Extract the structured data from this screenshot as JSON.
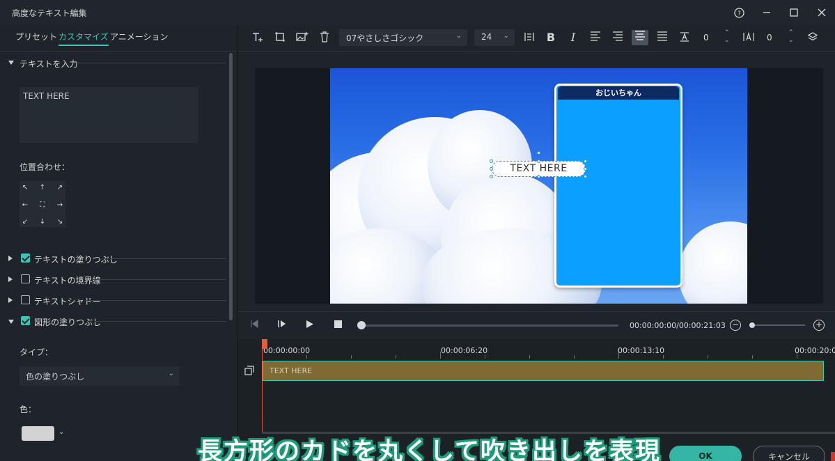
{
  "window": {
    "title": "高度なテキスト編集",
    "help_icon": "help-icon",
    "minimize_icon": "minimize-icon",
    "maximize_icon": "maximize-icon",
    "close_icon": "close-icon"
  },
  "tabs": [
    {
      "label": "プリセット",
      "active": false
    },
    {
      "label": "カスタマイズ",
      "active": true
    },
    {
      "label": "アニメーション",
      "active": false
    }
  ],
  "text_input": {
    "header": "テキストを入力",
    "value": "TEXT HERE"
  },
  "alignment": {
    "label": "位置合わせ：",
    "glyphs": [
      "↖",
      "↑",
      "↗",
      "←",
      "⛶",
      "→",
      "↙",
      "↓",
      "↘"
    ]
  },
  "sections": [
    {
      "label": "テキストの塗りつぶし",
      "checked": true,
      "expanded": false
    },
    {
      "label": "テキストの境界線",
      "checked": false,
      "expanded": false
    },
    {
      "label": "テキストシャドー",
      "checked": false,
      "expanded": false
    },
    {
      "label": "図形の塗りつぶし",
      "checked": true,
      "expanded": true
    }
  ],
  "shape_fill": {
    "type_label": "タイプ：",
    "type_value": "色の塗りつぶし",
    "color_label": "色：",
    "color_value": "#d3d3d3"
  },
  "toolbar": {
    "font": "07やさしさゴシック",
    "size": "24",
    "line_spacing": "0",
    "char_spacing": "0",
    "bold": "B",
    "italic": "I"
  },
  "preview": {
    "phone_header": "おじいちゃん",
    "bubble_text": "TEXT HERE",
    "sky_color": "#2a6fe6",
    "phone_color": "#0ba0ff"
  },
  "playback": {
    "timecode": "00:00:00:00/00:00:21:03"
  },
  "timeline": {
    "ruler": [
      "00:00:00:00",
      "00:00:06:20",
      "00:00:13:10",
      "00:00:20:00"
    ],
    "clip_label": "TEXT HERE",
    "clip_color": "#7f6a31",
    "playhead_color": "#e35d3c"
  },
  "buttons": {
    "ok": "OK",
    "cancel": "キャンセル"
  },
  "caption": "長方形のカドを丸くして吹き出しを表現",
  "accent": "#3ec3b5"
}
